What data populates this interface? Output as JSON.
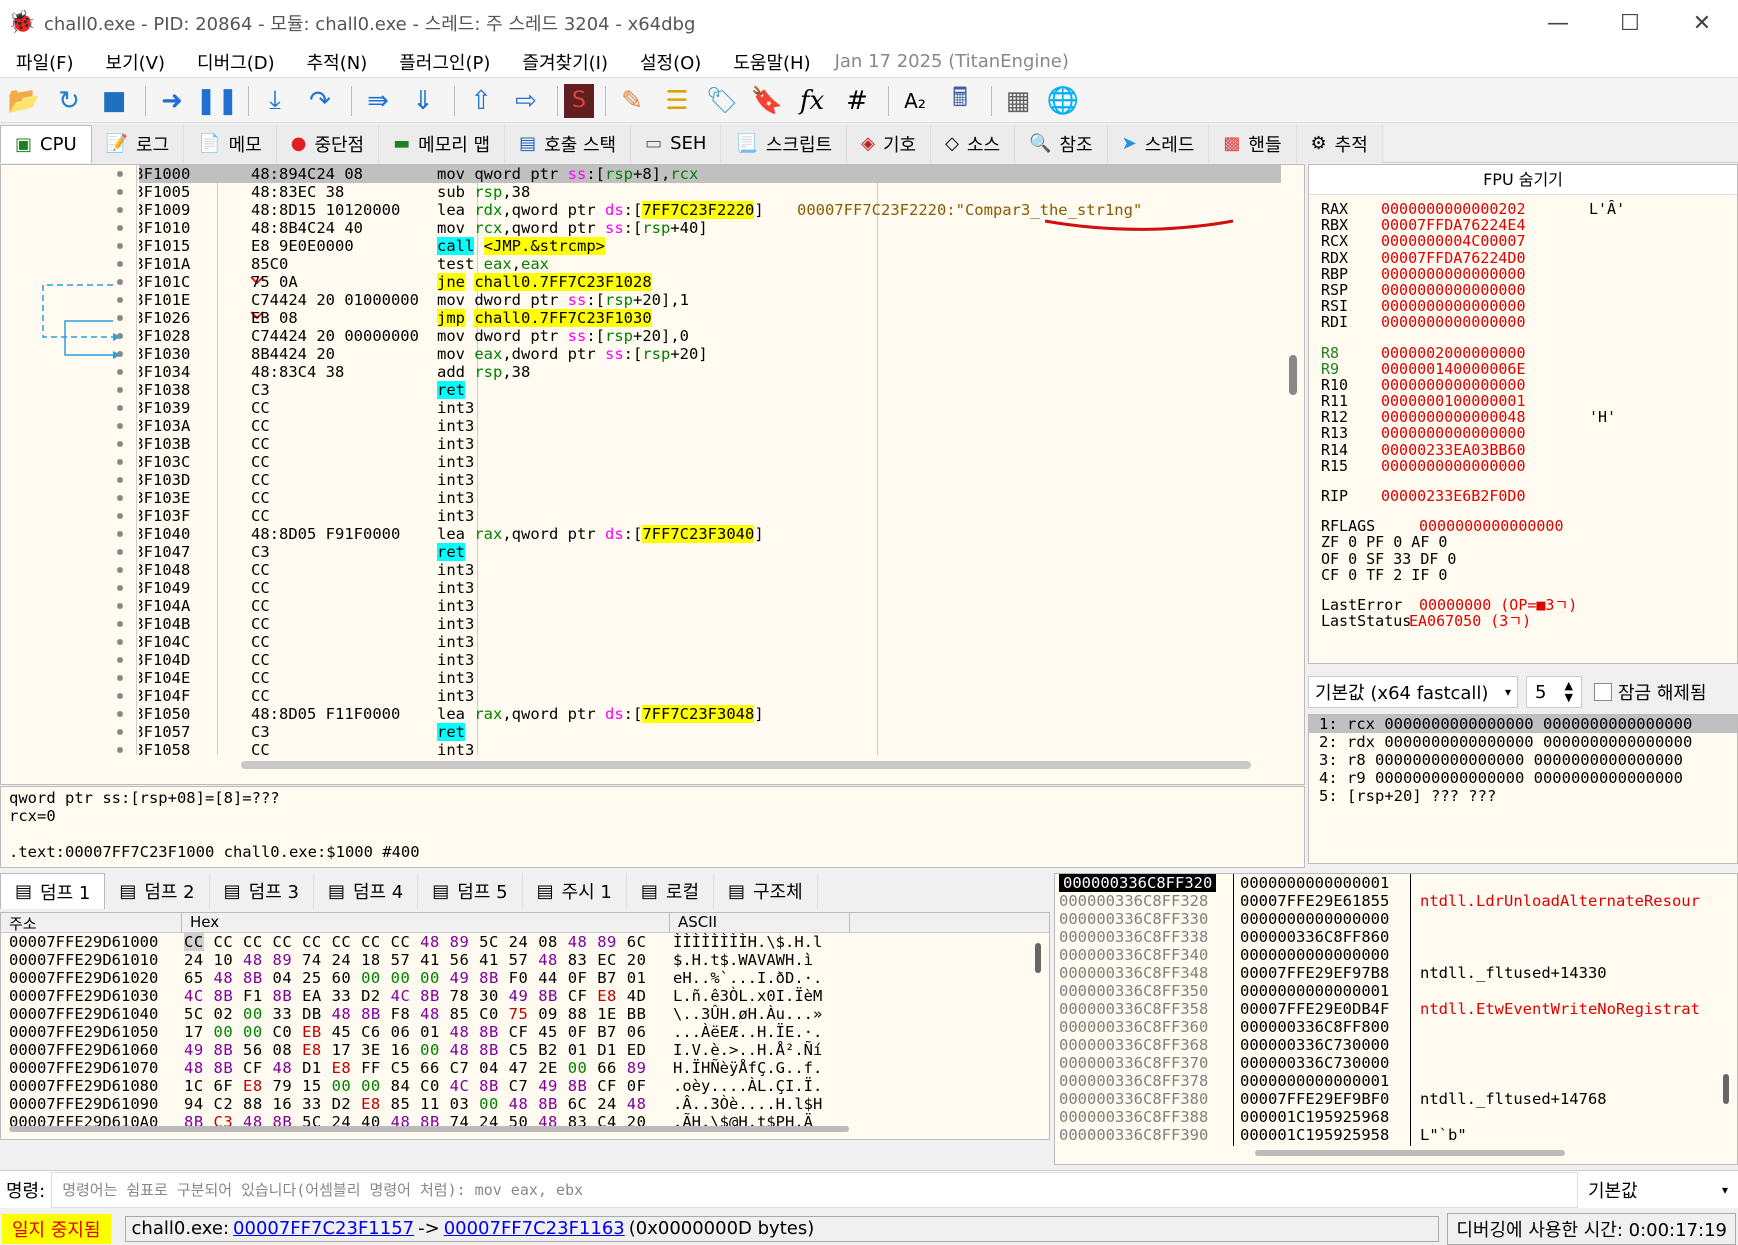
{
  "window": {
    "title": "chall0.exe - PID: 20864 - 모듈: chall0.exe - 스레드: 주 스레드 3204 - x64dbg"
  },
  "menu": {
    "items": [
      "파일(F)",
      "보기(V)",
      "디버그(D)",
      "추적(N)",
      "플러그인(P)",
      "즐겨찾기(I)",
      "설정(O)",
      "도움말(H)"
    ],
    "date": "Jan 17 2025 (TitanEngine)"
  },
  "toolbar": {
    "icons": [
      "open-icon",
      "restart-icon",
      "stop-icon",
      "run-icon",
      "pause-icon",
      "step-into-icon",
      "step-over-icon",
      "trace-into-icon",
      "trace-over-icon",
      "execute-till-return-icon",
      "run-to-user-code-icon",
      "scylla-icon",
      "patch-icon",
      "comments-icon",
      "labels-icon",
      "bookmarks-icon",
      "functions-icon",
      "variables-icon",
      "font-icon",
      "calculator-icon",
      "memory-map-icon",
      "help-icon"
    ]
  },
  "tabs": [
    {
      "label": "CPU",
      "icon": "cpu-icon"
    },
    {
      "label": "로그",
      "icon": "log-icon"
    },
    {
      "label": "메모",
      "icon": "notes-icon"
    },
    {
      "label": "중단점",
      "icon": "breakpoint-icon"
    },
    {
      "label": "메모리 맵",
      "icon": "memory-map-icon"
    },
    {
      "label": "호출 스택",
      "icon": "call-stack-icon"
    },
    {
      "label": "SEH",
      "icon": "seh-icon"
    },
    {
      "label": "스크립트",
      "icon": "script-icon"
    },
    {
      "label": "기호",
      "icon": "symbols-icon"
    },
    {
      "label": "소스",
      "icon": "source-icon"
    },
    {
      "label": "참조",
      "icon": "references-icon"
    },
    {
      "label": "스레드",
      "icon": "threads-icon"
    },
    {
      "label": "핸들",
      "icon": "handles-icon"
    },
    {
      "label": "추적",
      "icon": "trace-icon"
    }
  ],
  "disasm": {
    "rows": [
      {
        "addr": "23F1000",
        "bytes": "48:894C24 08",
        "instr": "mov qword ptr ss:[rsp+8],rcx",
        "comment": ""
      },
      {
        "addr": "23F1005",
        "bytes": "48:83EC 38",
        "instr": "sub rsp,38",
        "comment": ""
      },
      {
        "addr": "23F1009",
        "bytes": "48:8D15 10120000",
        "instr": "lea rdx,qword ptr ds:[7FF7C23F2220]",
        "comment": "00007FF7C23F2220:\"Compar3_the_str1ng\""
      },
      {
        "addr": "23F1010",
        "bytes": "48:8B4C24 40",
        "instr": "mov rcx,qword ptr ss:[rsp+40]",
        "comment": ""
      },
      {
        "addr": "23F1015",
        "bytes": "E8 9E0E0000",
        "instr": "call <JMP.&strcmp>",
        "comment": ""
      },
      {
        "addr": "23F101A",
        "bytes": "85C0",
        "instr": "test eax,eax",
        "comment": ""
      },
      {
        "addr": "23F101C",
        "bytes": "75 0A",
        "instr": "jne chall0.7FF7C23F1028",
        "comment": ""
      },
      {
        "addr": "23F101E",
        "bytes": "C74424 20 01000000",
        "instr": "mov dword ptr ss:[rsp+20],1",
        "comment": ""
      },
      {
        "addr": "23F1026",
        "bytes": "EB 08",
        "instr": "jmp chall0.7FF7C23F1030",
        "comment": ""
      },
      {
        "addr": "23F1028",
        "bytes": "C74424 20 00000000",
        "instr": "mov dword ptr ss:[rsp+20],0",
        "comment": ""
      },
      {
        "addr": "23F1030",
        "bytes": "8B4424 20",
        "instr": "mov eax,dword ptr ss:[rsp+20]",
        "comment": ""
      },
      {
        "addr": "23F1034",
        "bytes": "48:83C4 38",
        "instr": "add rsp,38",
        "comment": ""
      },
      {
        "addr": "23F1038",
        "bytes": "C3",
        "instr": "ret",
        "comment": ""
      },
      {
        "addr": "23F1039",
        "bytes": "CC",
        "instr": "int3",
        "comment": ""
      },
      {
        "addr": "23F103A",
        "bytes": "CC",
        "instr": "int3",
        "comment": ""
      },
      {
        "addr": "23F103B",
        "bytes": "CC",
        "instr": "int3",
        "comment": ""
      },
      {
        "addr": "23F103C",
        "bytes": "CC",
        "instr": "int3",
        "comment": ""
      },
      {
        "addr": "23F103D",
        "bytes": "CC",
        "instr": "int3",
        "comment": ""
      },
      {
        "addr": "23F103E",
        "bytes": "CC",
        "instr": "int3",
        "comment": ""
      },
      {
        "addr": "23F103F",
        "bytes": "CC",
        "instr": "int3",
        "comment": ""
      },
      {
        "addr": "23F1040",
        "bytes": "48:8D05 F91F0000",
        "instr": "lea rax,qword ptr ds:[7FF7C23F3040]",
        "comment": ""
      },
      {
        "addr": "23F1047",
        "bytes": "C3",
        "instr": "ret",
        "comment": ""
      },
      {
        "addr": "23F1048",
        "bytes": "CC",
        "instr": "int3",
        "comment": ""
      },
      {
        "addr": "23F1049",
        "bytes": "CC",
        "instr": "int3",
        "comment": ""
      },
      {
        "addr": "23F104A",
        "bytes": "CC",
        "instr": "int3",
        "comment": ""
      },
      {
        "addr": "23F104B",
        "bytes": "CC",
        "instr": "int3",
        "comment": ""
      },
      {
        "addr": "23F104C",
        "bytes": "CC",
        "instr": "int3",
        "comment": ""
      },
      {
        "addr": "23F104D",
        "bytes": "CC",
        "instr": "int3",
        "comment": ""
      },
      {
        "addr": "23F104E",
        "bytes": "CC",
        "instr": "int3",
        "comment": ""
      },
      {
        "addr": "23F104F",
        "bytes": "CC",
        "instr": "int3",
        "comment": ""
      },
      {
        "addr": "23F1050",
        "bytes": "48:8D05 F11F0000",
        "instr": "lea rax,qword ptr ds:[7FF7C23F3048]",
        "comment": ""
      },
      {
        "addr": "23F1057",
        "bytes": "C3",
        "instr": "ret",
        "comment": ""
      },
      {
        "addr": "23F1058",
        "bytes": "CC",
        "instr": "int3",
        "comment": ""
      }
    ]
  },
  "info": {
    "line1": "qword ptr ss:[rsp+08]=[8]=???",
    "line2": "rcx=0",
    "line3": "",
    "line4": ".text:00007FF7C23F1000 chall0.exe:$1000 #400"
  },
  "registers": {
    "header": "FPU 숨기기",
    "general": [
      {
        "name": "RAX",
        "value": "0000000000000202",
        "ext": "L'Ȃ'"
      },
      {
        "name": "RBX",
        "value": "00007FFDA76224E4",
        "ext": ""
      },
      {
        "name": "RCX",
        "value": "0000000004C00007",
        "ext": ""
      },
      {
        "name": "RDX",
        "value": "00007FFDA76224D0",
        "ext": ""
      },
      {
        "name": "RBP",
        "value": "0000000000000000",
        "ext": ""
      },
      {
        "name": "RSP",
        "value": "0000000000000000",
        "ext": ""
      },
      {
        "name": "RSI",
        "value": "0000000000000000",
        "ext": ""
      },
      {
        "name": "RDI",
        "value": "0000000000000000",
        "ext": ""
      }
    ],
    "extended": [
      {
        "name": "R8",
        "value": "0000002000000000",
        "ext": ""
      },
      {
        "name": "R9",
        "value": "000000140000006E",
        "ext": ""
      },
      {
        "name": "R10",
        "value": "0000000000000000",
        "ext": ""
      },
      {
        "name": "R11",
        "value": "0000000100000001",
        "ext": ""
      },
      {
        "name": "R12",
        "value": "0000000000000048",
        "ext": "'H'"
      },
      {
        "name": "R13",
        "value": "0000000000000000",
        "ext": ""
      },
      {
        "name": "R14",
        "value": "00000233EA03BB60",
        "ext": ""
      },
      {
        "name": "R15",
        "value": "0000000000000000",
        "ext": ""
      }
    ],
    "rip": {
      "name": "RIP",
      "value": "00000233E6B2F0D0"
    },
    "rflags": {
      "name": "RFLAGS",
      "value": "0000000000000000"
    },
    "flags_rows": [
      "ZF 0  PF 0  AF 0",
      "OF 0  SF 33 DF 0",
      "CF 0  TF 2  IF 0"
    ],
    "last_error": {
      "name": "LastError",
      "value": "00000000 (OP=■3ㄱ)"
    },
    "last_status": {
      "name": "LastStatus",
      "value": "EA067050 (3ㄱ)"
    }
  },
  "callconv": {
    "selected": "기본값 (x64 fastcall)",
    "count": "5",
    "unlock_label": "잠금 해제됨"
  },
  "args": [
    "1: rcx 0000000000000000 0000000000000000",
    "2: rdx 0000000000000000 0000000000000000",
    "3: r8 0000000000000000 0000000000000000",
    "4: r9 0000000000000000 0000000000000000",
    "5: [rsp+20] ??? ???"
  ],
  "dump_tabs": [
    {
      "label": "덤프 1",
      "icon": "dump-icon"
    },
    {
      "label": "덤프 2",
      "icon": "dump-icon"
    },
    {
      "label": "덤프 3",
      "icon": "dump-icon"
    },
    {
      "label": "덤프 4",
      "icon": "dump-icon"
    },
    {
      "label": "덤프 5",
      "icon": "dump-icon"
    },
    {
      "label": "주시 1",
      "icon": "watch-icon"
    },
    {
      "label": "로컬",
      "icon": "locals-icon"
    },
    {
      "label": "구조체",
      "icon": "struct-icon"
    }
  ],
  "dump": {
    "headers": [
      "주소",
      "Hex",
      "ASCII"
    ],
    "rows": [
      {
        "addr": "00007FFE29D61000",
        "hex": "CC CC CC CC CC CC CC CC 48 89 5C 24 08 48 89 6C",
        "ascii": "ÌÌÌÌÌÌÌÌH.\\$.H.l"
      },
      {
        "addr": "00007FFE29D61010",
        "hex": "24 10 48 89 74 24 18 57 41 56 41 57 48 83 EC 20",
        "ascii": "$.H.t$.WAVAWH.ì "
      },
      {
        "addr": "00007FFE29D61020",
        "hex": "65 48 8B 04 25 60 00 00 00 49 8B F0 44 0F B7 01",
        "ascii": "eH..%`...I.ðD.·."
      },
      {
        "addr": "00007FFE29D61030",
        "hex": "4C 8B F1 8B EA 33 D2 4C 8B 78 30 49 8B CF E8 4D",
        "ascii": "L.ñ.ê3ÒL.x0I.ÏèM"
      },
      {
        "addr": "00007FFE29D61040",
        "hex": "5C 02 00 33 DB 48 8B F8 48 85 C0 75 09 88 1E BB",
        "ascii": "\\..3ÛH.øH.Àu...»"
      },
      {
        "addr": "00007FFE29D61050",
        "hex": "17 00 00 C0 EB 45 C6 06 01 48 8B CF 45 0F B7 06",
        "ascii": "...ÀëEÆ..H.ÏE.·."
      },
      {
        "addr": "00007FFE29D61060",
        "hex": "49 8B 56 08 E8 17 3E 16 00 48 8B C5 B2 01 D1 ED",
        "ascii": "I.V.è.>..H.Å².Ñí"
      },
      {
        "addr": "00007FFE29D61070",
        "hex": "48 8B CF 48 D1 E8 FF C5 66 C7 04 47 2E 00 66 89",
        "ascii": "H.ÏHÑèÿÅfÇ.G..f."
      },
      {
        "addr": "00007FFE29D61080",
        "hex": "1C 6F E8 79 15 00 00 84 C0 4C 8B C7 49 8B CF 0F",
        "ascii": ".oèy....ÀL.ÇI.Ï."
      },
      {
        "addr": "00007FFE29D61090",
        "hex": "94 C2 88 16 33 D2 E8 85 11 03 00 48 8B 6C 24 48",
        "ascii": ".Â..3Òè....H.l$H"
      },
      {
        "addr": "00007FFE29D610A0",
        "hex": "8B C3 48 8B 5C 24 40 48 8B 74 24 50 48 83 C4 20",
        "ascii": ".ÃH.\\$@H.t$PH.Ä "
      }
    ]
  },
  "stack": {
    "rows": [
      {
        "addr": "000000336C8FF320",
        "value": "0000000000000001",
        "comment": "",
        "red": false
      },
      {
        "addr": "000000336C8FF328",
        "value": "00007FFE29E61855",
        "comment": "ntdll.LdrUnloadAlternateResour",
        "red": true
      },
      {
        "addr": "000000336C8FF330",
        "value": "0000000000000000",
        "comment": "",
        "red": false
      },
      {
        "addr": "000000336C8FF338",
        "value": "000000336C8FF860",
        "comment": "",
        "red": false
      },
      {
        "addr": "000000336C8FF340",
        "value": "0000000000000000",
        "comment": "",
        "red": false
      },
      {
        "addr": "000000336C8FF348",
        "value": "00007FFE29EF97B8",
        "comment": "ntdll._fltused+14330",
        "red": false
      },
      {
        "addr": "000000336C8FF350",
        "value": "0000000000000001",
        "comment": "",
        "red": false
      },
      {
        "addr": "000000336C8FF358",
        "value": "00007FFE29E0DB4F",
        "comment": "ntdll.EtwEventWriteNoRegistrat",
        "red": true
      },
      {
        "addr": "000000336C8FF360",
        "value": "000000336C8FF800",
        "comment": "",
        "red": false
      },
      {
        "addr": "000000336C8FF368",
        "value": "000000336C730000",
        "comment": "",
        "red": false
      },
      {
        "addr": "000000336C8FF370",
        "value": "000000336C730000",
        "comment": "",
        "red": false
      },
      {
        "addr": "000000336C8FF378",
        "value": "0000000000000001",
        "comment": "",
        "red": false
      },
      {
        "addr": "000000336C8FF380",
        "value": "00007FFE29EF9BF0",
        "comment": "ntdll._fltused+14768",
        "red": false
      },
      {
        "addr": "000000336C8FF388",
        "value": "000001C195925968",
        "comment": "",
        "red": false
      },
      {
        "addr": "000000336C8FF390",
        "value": "000001C195925958",
        "comment": "L\"`b\"",
        "red": false
      }
    ]
  },
  "command": {
    "label": "명령:",
    "placeholder": "명령어는 쉼표로 구분되어 있습니다(어셈블리 명령어 처럼): mov eax, ebx",
    "mode": "기본값"
  },
  "status": {
    "state": "일지 중지됨",
    "prefix": "chall0.exe:",
    "from": "00007FF7C23F1157",
    "arrow": "->",
    "to": "00007FF7C23F1163",
    "suffix": "(0x0000000D bytes)",
    "timer": "디버깅에 사용한 시간: 0:00:17:19"
  }
}
